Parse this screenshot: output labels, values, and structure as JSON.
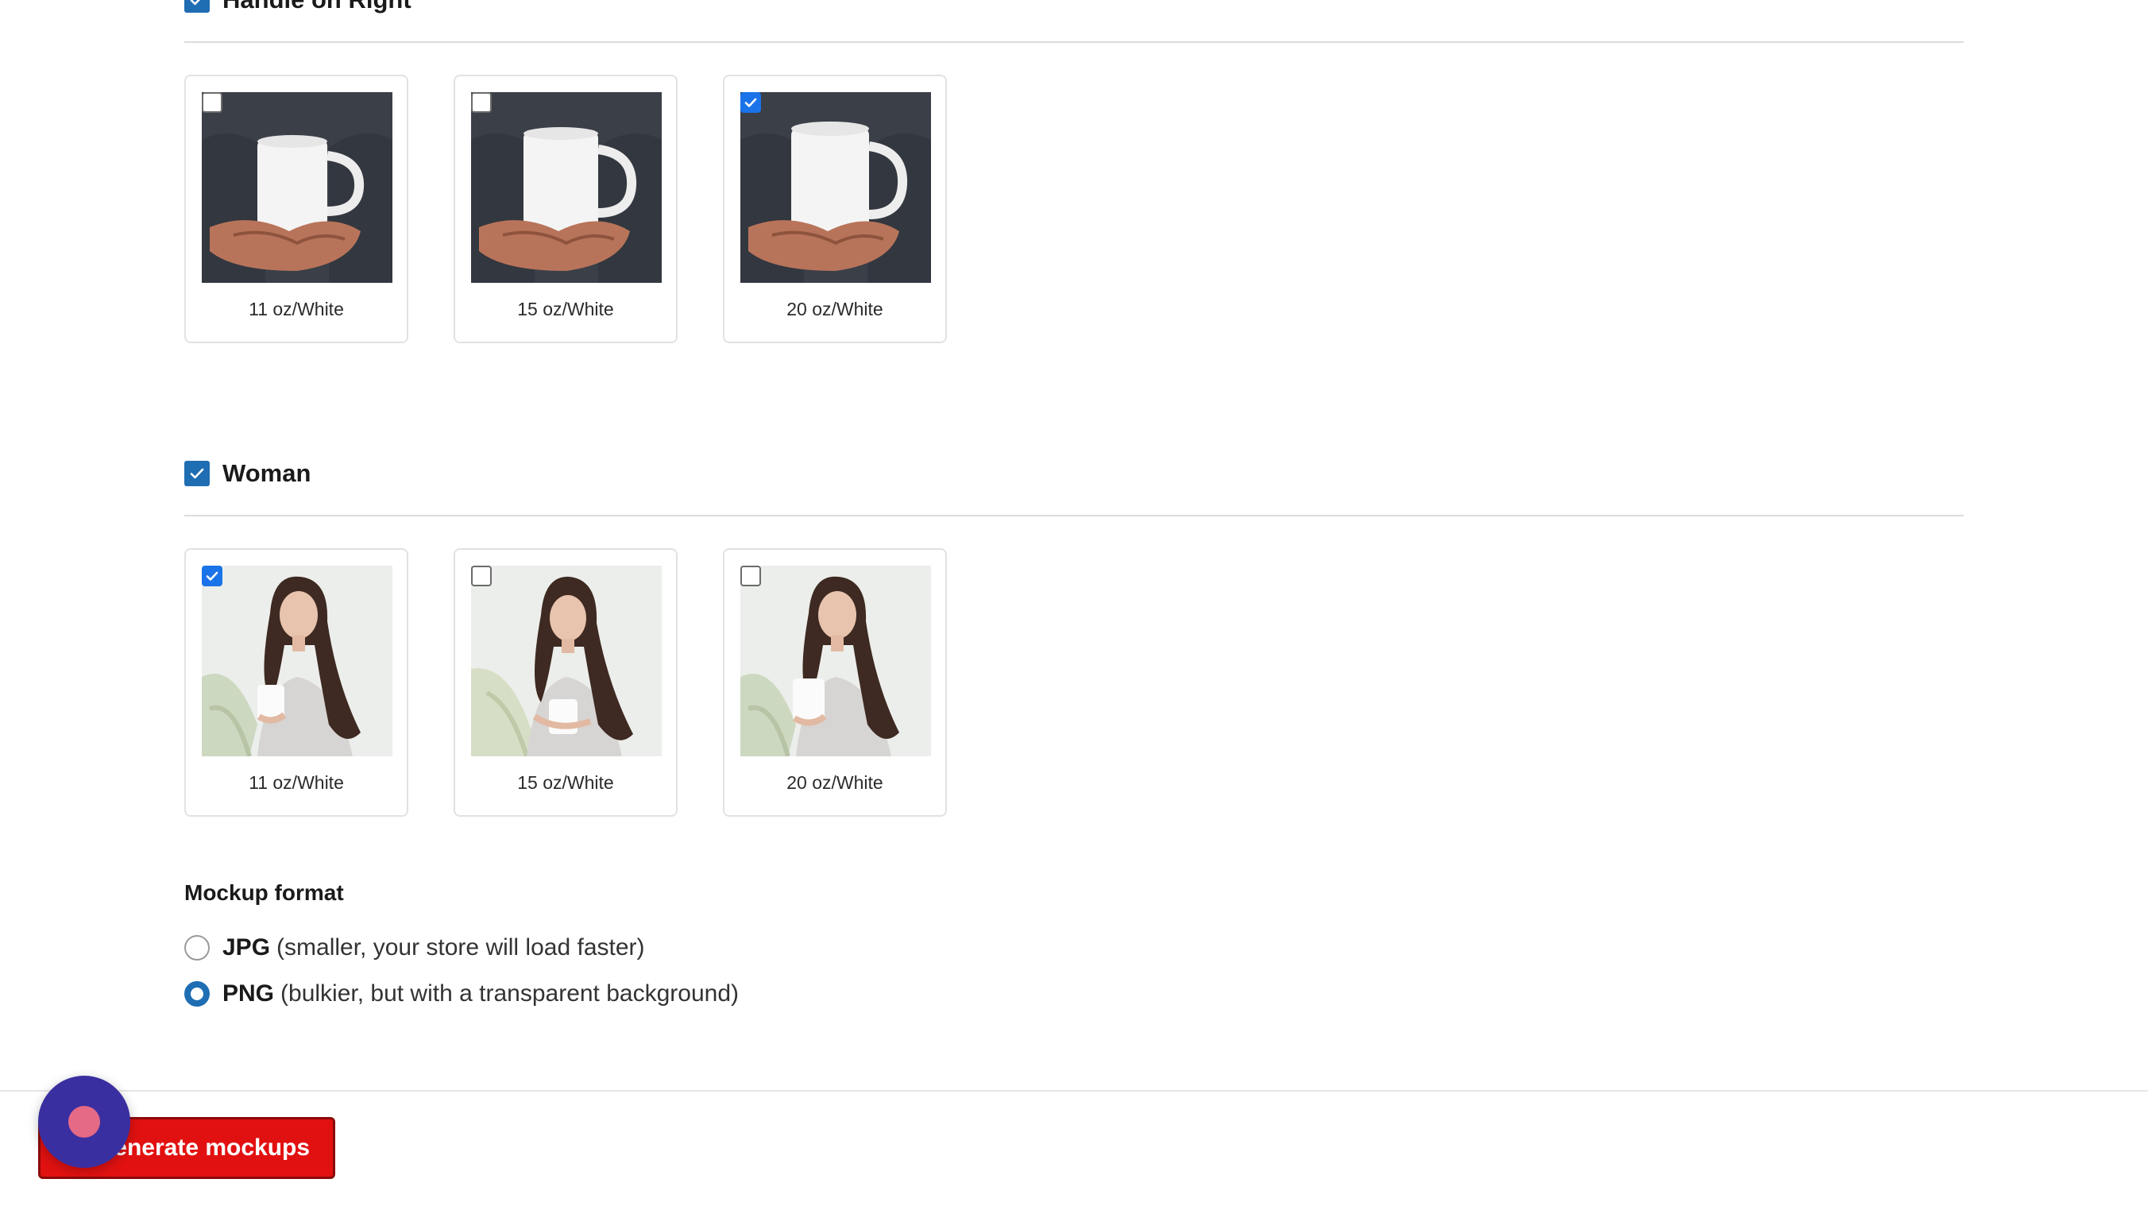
{
  "groups": [
    {
      "label": "Handle on Right",
      "checked": true,
      "variants": [
        {
          "label": "11 oz/White",
          "checked": false
        },
        {
          "label": "15 oz/White",
          "checked": false
        },
        {
          "label": "20 oz/White",
          "checked": true
        }
      ]
    },
    {
      "label": "Woman",
      "checked": true,
      "variants": [
        {
          "label": "11 oz/White",
          "checked": true
        },
        {
          "label": "15 oz/White",
          "checked": false
        },
        {
          "label": "20 oz/White",
          "checked": false
        }
      ]
    }
  ],
  "mockup_format": {
    "title": "Mockup format",
    "options": [
      {
        "name": "JPG",
        "description": "(smaller, your store will load faster)",
        "selected": false
      },
      {
        "name": "PNG",
        "description": "(bulkier, but with a transparent background)",
        "selected": true
      }
    ]
  },
  "footer": {
    "generate_label": "Generate mockups"
  },
  "colors": {
    "brand_blue": "#1f6db3",
    "checkbox_blue": "#1a73e8",
    "generate_red": "#e21111",
    "fab_purple": "#3a2fa0"
  }
}
